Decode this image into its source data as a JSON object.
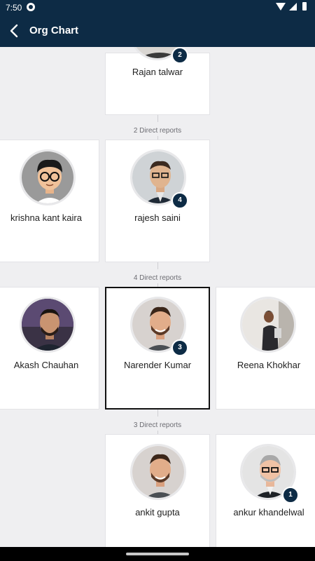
{
  "status_bar": {
    "time": "7:50"
  },
  "app_bar": {
    "title": "Org Chart"
  },
  "level1": {
    "name": "Rajan talwar",
    "badge": "2"
  },
  "level1_reports": "2 Direct reports",
  "level2": [
    {
      "name": "krishna kant kaira"
    },
    {
      "name": "rajesh saini",
      "badge": "4"
    }
  ],
  "level2_reports": "4 Direct reports",
  "level3": [
    {
      "name": "Akash Chauhan"
    },
    {
      "name": "Narender Kumar",
      "badge": "3"
    },
    {
      "name": "Reena Khokhar"
    }
  ],
  "level3_reports": "3 Direct reports",
  "level4": [
    {
      "name": "ankit gupta"
    },
    {
      "name": "ankur khandelwal",
      "badge": "1"
    }
  ],
  "colors": {
    "primary": "#0d2b45",
    "background": "#efeff1",
    "card": "#ffffff"
  },
  "icons": {
    "back": "chevron-left-icon"
  }
}
